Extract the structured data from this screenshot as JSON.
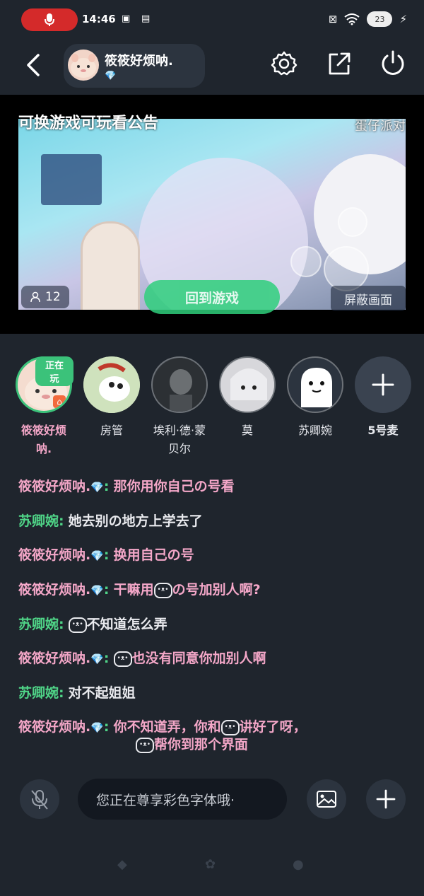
{
  "status_bar": {
    "time": "14:46",
    "battery": "23"
  },
  "header": {
    "room_name": "筱筱好烦呐.",
    "room_badge": "💎"
  },
  "video": {
    "title": "可换游戏可玩看公告",
    "game_label": "蛋仔派对",
    "viewer_count": "12",
    "return_label": "回到游戏",
    "block_label": "屏蔽画面"
  },
  "seats": [
    {
      "name": "筱筱好烦\n呐.",
      "badge": "正在玩"
    },
    {
      "name": "房管"
    },
    {
      "name": "埃利·德·蒙\n贝尔"
    },
    {
      "name": "莫"
    },
    {
      "name": "苏卿婉"
    },
    {
      "name": "5号麦"
    }
  ],
  "chat": [
    {
      "user": "筱筱好烦呐.",
      "gem": "💎",
      "color": "pink",
      "text": "那你用你自己の号看"
    },
    {
      "user": "苏卿婉",
      "color": "green",
      "text": "她去别の地方上学去了"
    },
    {
      "user": "筱筱好烦呐.",
      "gem": "💎",
      "color": "pink",
      "text": "换用自己の号"
    },
    {
      "user": "筱筱好烦呐.",
      "gem": "💎",
      "color": "pink",
      "text_a": "干嘛用",
      "text_b": "の号加别人啊?"
    },
    {
      "user": "苏卿婉",
      "color": "green",
      "text": "不知道怎么弄"
    },
    {
      "user": "筱筱好烦呐.",
      "gem": "💎",
      "color": "pink",
      "text": "也没有同意你加别人啊"
    },
    {
      "user": "苏卿婉",
      "color": "green",
      "text": "对不起姐姐"
    },
    {
      "user": "筱筱好烦呐.",
      "gem": "💎",
      "color": "pink",
      "text_a": "你不知道弄，你和",
      "text_b": "讲好了呀，",
      "text_c": "帮你到那个界面"
    }
  ],
  "input": {
    "placeholder": "您正在尊享彩色字体哦·"
  },
  "colors": {
    "pink": "#f4a7c8",
    "green": "#4fd487",
    "accent_green": "#2fcf7c",
    "bg": "#1f252d"
  }
}
